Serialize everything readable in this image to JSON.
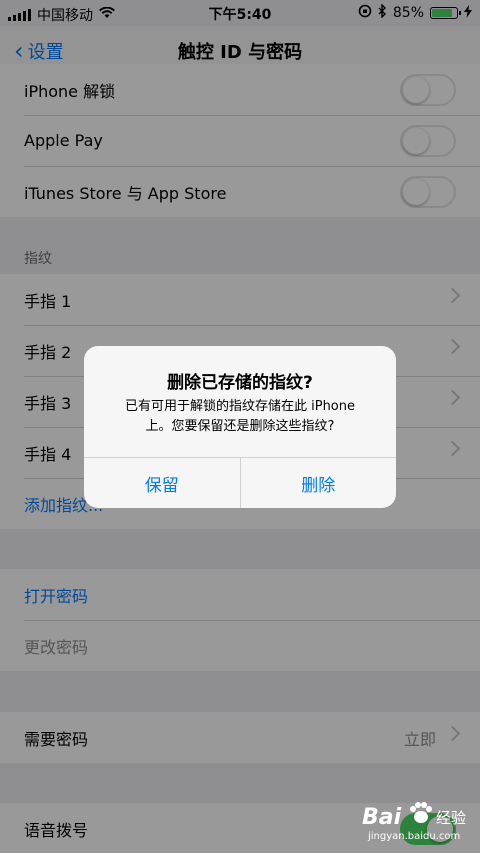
{
  "status": {
    "carrier": "中国移动",
    "time": "下午5:40",
    "battery": "85%",
    "battery_level": 0.85
  },
  "nav": {
    "back_label": "设置",
    "title": "触控 ID 与密码"
  },
  "unlock_group": {
    "items": [
      {
        "label": "iPhone 解锁",
        "on": false
      },
      {
        "label": "Apple Pay",
        "on": false
      },
      {
        "label": "iTunes Store 与 App Store",
        "on": false
      }
    ]
  },
  "fingerprints": {
    "header": "指纹",
    "items": [
      "手指 1",
      "手指 2",
      "手指 3",
      "手指 4"
    ],
    "add_label": "添加指纹..."
  },
  "passcode": {
    "turn_on": "打开密码",
    "change": "更改密码"
  },
  "require": {
    "label": "需要密码",
    "value": "立即"
  },
  "voice_dial": {
    "label": "语音拨号"
  },
  "alert": {
    "title": "删除已存储的指纹?",
    "message_line1": "已有可用于解锁的指纹存储在此 iPhone",
    "message_line2": "上。您要保留还是删除这些指纹?",
    "keep": "保留",
    "delete": "删除"
  },
  "watermark": {
    "logo": "Bai",
    "brand": "经验",
    "url": "jingyan.baidu.com"
  }
}
